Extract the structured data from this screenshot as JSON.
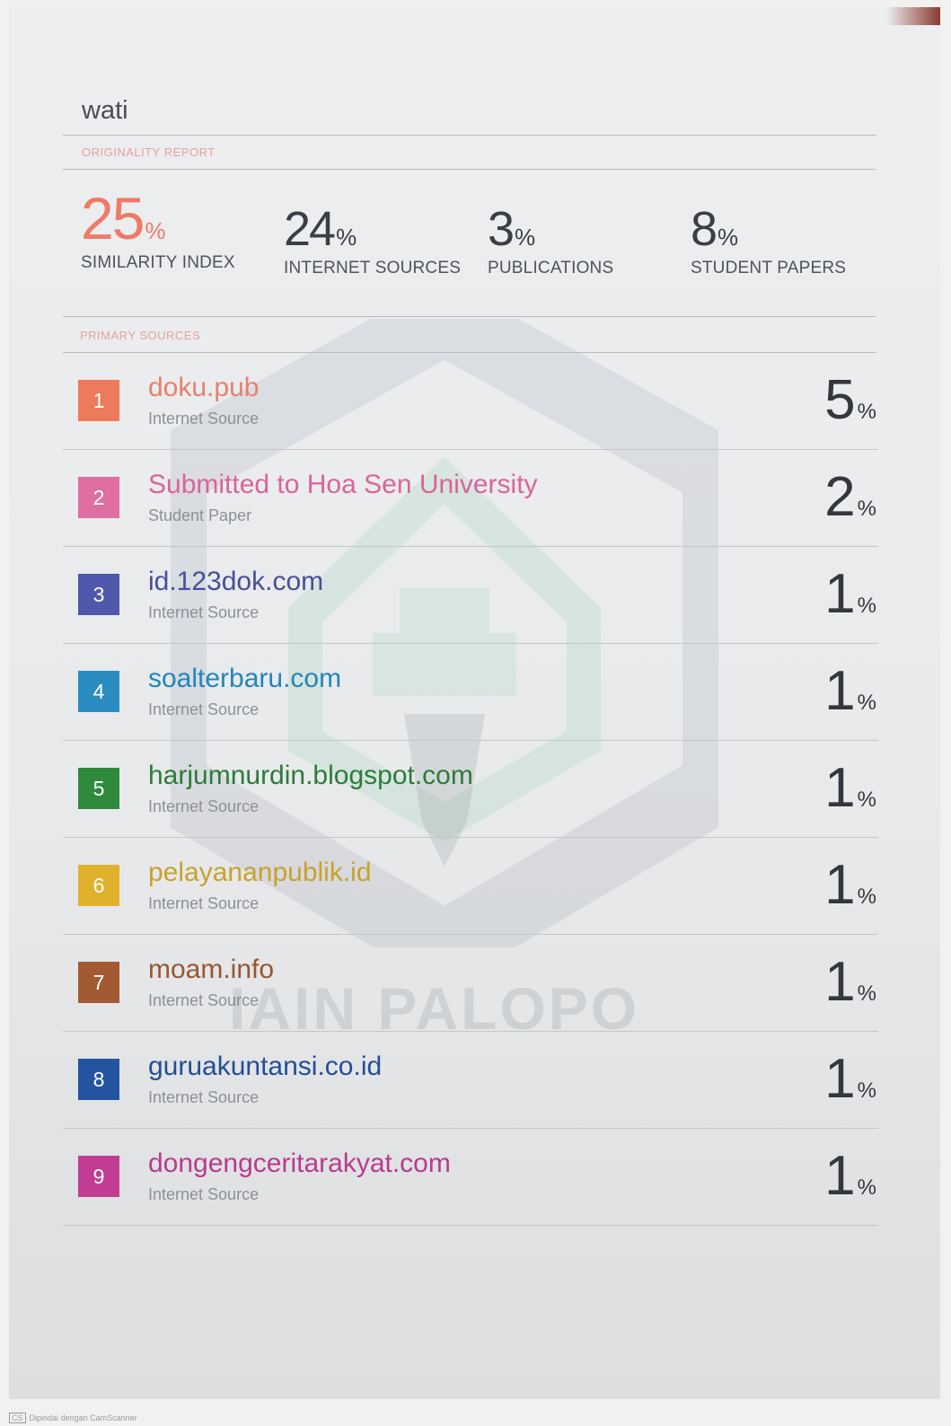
{
  "document": {
    "title": "wati"
  },
  "report": {
    "originality_label": "ORIGINALITY REPORT",
    "primary_sources_label": "PRIMARY SOURCES"
  },
  "stats": {
    "similarity": {
      "value": "25",
      "pct": "%",
      "label": "SIMILARITY INDEX",
      "color": "#ee7a67"
    },
    "internet": {
      "value": "24",
      "pct": "%",
      "label": "INTERNET SOURCES"
    },
    "publications": {
      "value": "3",
      "pct": "%",
      "label": "PUBLICATIONS"
    },
    "students": {
      "value": "8",
      "pct": "%",
      "label": "STUDENT PAPERS"
    }
  },
  "sources": [
    {
      "rank": "1",
      "name": "doku.pub",
      "type": "Internet Source",
      "share": "5",
      "pct": "%",
      "color": "#ee7a5c",
      "text_color": "#e8806c"
    },
    {
      "rank": "2",
      "name": "Submitted to Hoa Sen University",
      "type": "Student Paper",
      "share": "2",
      "pct": "%",
      "color": "#df6ea2",
      "text_color": "#d8659c"
    },
    {
      "rank": "3",
      "name": "id.123dok.com",
      "type": "Internet Source",
      "share": "1",
      "pct": "%",
      "color": "#4f58ad",
      "text_color": "#474f9c"
    },
    {
      "rank": "4",
      "name": "soalterbaru.com",
      "type": "Internet Source",
      "share": "1",
      "pct": "%",
      "color": "#2b8cc2",
      "text_color": "#2385bb"
    },
    {
      "rank": "5",
      "name": "harjumnurdin.blogspot.com",
      "type": "Internet Source",
      "share": "1",
      "pct": "%",
      "color": "#2f8a3c",
      "text_color": "#2b7d36"
    },
    {
      "rank": "6",
      "name": "pelayananpublik.id",
      "type": "Internet Source",
      "share": "1",
      "pct": "%",
      "color": "#e0b22c",
      "text_color": "#c9a22a"
    },
    {
      "rank": "7",
      "name": "moam.info",
      "type": "Internet Source",
      "share": "1",
      "pct": "%",
      "color": "#a35a33",
      "text_color": "#9a5530"
    },
    {
      "rank": "8",
      "name": "guruakuntansi.co.id",
      "type": "Internet Source",
      "share": "1",
      "pct": "%",
      "color": "#2454a0",
      "text_color": "#234e95"
    },
    {
      "rank": "9",
      "name": "dongengceritarakyat.com",
      "type": "Internet Source",
      "share": "1",
      "pct": "%",
      "color": "#c13d93",
      "text_color": "#b83b8c"
    }
  ],
  "watermark": {
    "text": "IAIN PALOPO"
  },
  "footer": {
    "badge": "CS",
    "text": "Dipindai dengan CamScanner"
  }
}
